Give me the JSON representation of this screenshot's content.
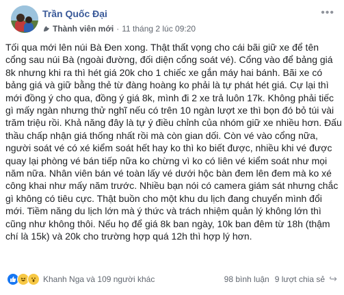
{
  "author": {
    "name": "Trần Quốc Đại",
    "role": "Thành viên mới",
    "timestamp": "11 tháng 2 lúc 09:20"
  },
  "post": {
    "text": "Tối qua mới lên núi Bà Đen xong. Thật thất vọng cho cái bãi giữ xe để tên cổng sau núi Bà (ngoài đường, đối diện cổng soát vé). Cổng vào để bảng giá 8k nhưng khi ra thì hét giá 20k cho 1 chiếc xe gắn máy hai bánh. Bãi xe có bảng giá và giữ bằng thẻ từ đàng hoàng ko phải là tự phát hét giá. Cự lại thì mới đồng ý cho qua, đồng ý giá 8k, mình đi 2 xe trả luôn 17k. Không phải tiếc gì mấy ngàn nhưng thử nghĩ nếu có trên 10 ngàn lượt xe thì bọn đó bỏ túi vài trăm triệu rồi. Khả năng đây là tự ý điều chỉnh của nhóm giữ xe nhiều hơn. Đấu thầu chấp nhận giá thống nhất rồi mà còn gian dối. Còn vé vào cổng nữa, người soát vé có xé kiểm soát hết hay ko thì ko biết được, nhiều khi vé được quay lại phòng vé bán tiếp nữa ko chừng vì ko có liên vé kiểm soát như mọi năm nữa. Nhân viên bán vé toàn lấy vé dưới hộc bàn đem lên đem mà ko xé công khai như mấy năm trước. Nhiều bạn nói có camera giám sát nhưng chắc gì không có tiêu cực. Thật buồn cho một khu du lịch đang chuyển mình đổi mới. Tiềm năng du lịch lớn mà ý thức và trách nhiệm quản lý không lớn thì cũng như không thôi. Nếu họ để giá 8k ban ngày, 10k ban đêm từ 18h (thậm chí là 15k) và 20k cho trường hợp quá 12h thì hợp lý hơn."
  },
  "footer": {
    "reactions_text": "Khanh Nga và 109 người khác",
    "comments_text": "98 bình luận",
    "shares_text": "9 lượt chia sẻ",
    "reaction_icons": [
      "like-icon",
      "haha-icon",
      "wow-icon"
    ]
  },
  "colors": {
    "author_link": "#385898",
    "meta_text": "#616770",
    "body_text": "#1c1e21",
    "like_blue": "#1877f2",
    "emoji_yellow": "#f7c845"
  }
}
